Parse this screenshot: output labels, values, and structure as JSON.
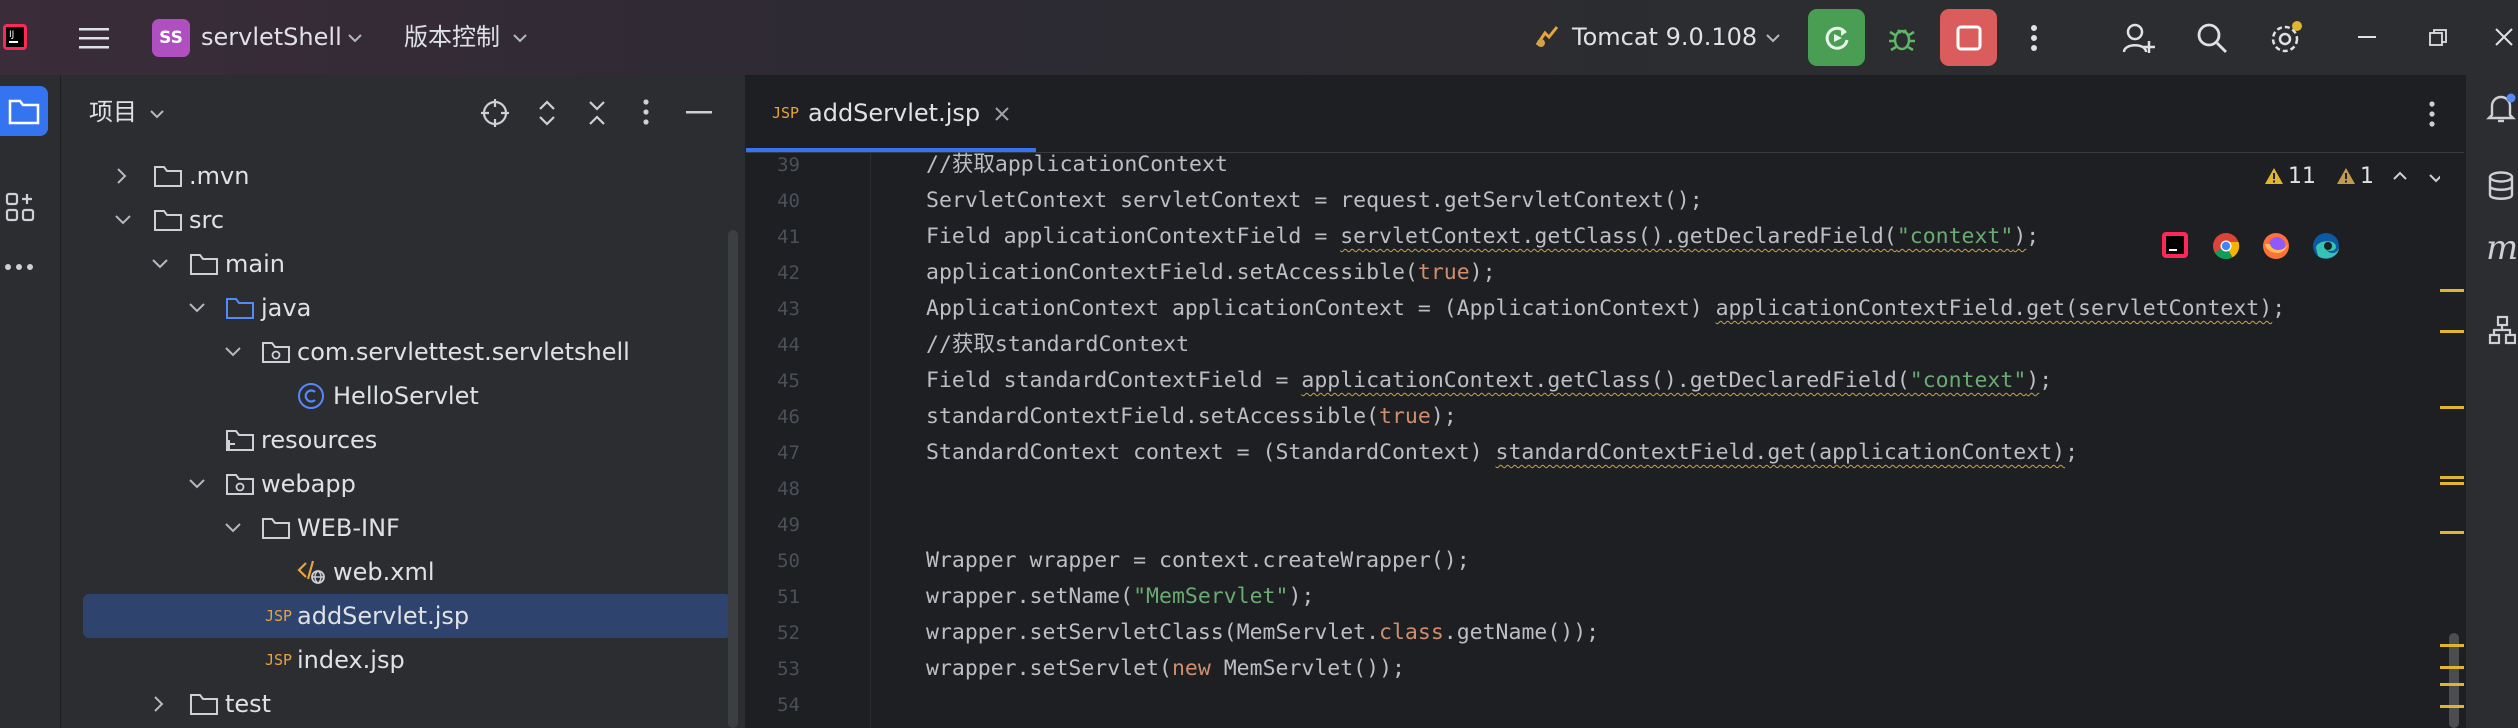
{
  "titlebar": {
    "project_badge": "SS",
    "project_name": "servletShell",
    "vcs_label": "版本控制",
    "run_config": "Tomcat 9.0.108"
  },
  "project_panel": {
    "title": "项目",
    "tree": [
      {
        "label": ".mvn",
        "type": "folder"
      },
      {
        "label": "src",
        "type": "folder"
      },
      {
        "label": "main",
        "type": "folder"
      },
      {
        "label": "java",
        "type": "source-folder"
      },
      {
        "label": "com.servlettest.servletshell",
        "type": "package"
      },
      {
        "label": "HelloServlet",
        "type": "class"
      },
      {
        "label": "resources",
        "type": "resource-folder"
      },
      {
        "label": "webapp",
        "type": "web-folder"
      },
      {
        "label": "WEB-INF",
        "type": "folder"
      },
      {
        "label": "web.xml",
        "type": "xml"
      },
      {
        "label": "addServlet.jsp",
        "type": "jsp"
      },
      {
        "label": "index.jsp",
        "type": "jsp"
      },
      {
        "label": "test",
        "type": "folder"
      }
    ]
  },
  "editor": {
    "tab_icon": "JSP",
    "tab_name": "addServlet.jsp",
    "warnings_count": "11",
    "weak_warnings_count": "1",
    "line_numbers": [
      "39",
      "40",
      "41",
      "42",
      "43",
      "44",
      "45",
      "46",
      "47",
      "48",
      "49",
      "50",
      "51",
      "52",
      "53",
      "54"
    ],
    "code": {
      "l39": "//获取applicationContext",
      "l40": "ServletContext servletContext = request.getServletContext();",
      "l41a": "Field applicationContextField = ",
      "l41b": "servletContext.getClass().getDeclaredField(",
      "l41c": "\"context\"",
      "l41d": ")",
      "l41e": ";",
      "l42a": "applicationContextField.setAccessible(",
      "l42b": "true",
      "l42c": ");",
      "l43a": "ApplicationContext applicationContext = (ApplicationContext) ",
      "l43b": "applicationContextField.get(servletContext)",
      "l43c": ";",
      "l44": "//获取standardContext",
      "l45a": "Field standardContextField = ",
      "l45b": "applicationContext.getClass().getDeclaredField(",
      "l45c": "\"context\"",
      "l45d": ")",
      "l45e": ";",
      "l46a": "standardContextField.setAccessible(",
      "l46b": "true",
      "l46c": ");",
      "l47a": "StandardContext context = (StandardContext) ",
      "l47b": "standardContextField.get(applicationContext)",
      "l47c": ";",
      "l50": "Wrapper wrapper = context.createWrapper();",
      "l51a": "wrapper.setName(",
      "l51b": "\"MemServlet\"",
      "l51c": ");",
      "l52a": "wrapper.setServletClass(MemServlet.",
      "l52b": "class",
      "l52c": ".getName());",
      "l53a": "wrapper.setServlet(",
      "l53b": "new",
      "l53c": " MemServlet());"
    }
  },
  "colors": {
    "run_button": "#4a9e53",
    "stop_button": "#db5c5c",
    "selection": "#2e436e",
    "accent": "#3574f0",
    "warning": "#e0b62f"
  }
}
